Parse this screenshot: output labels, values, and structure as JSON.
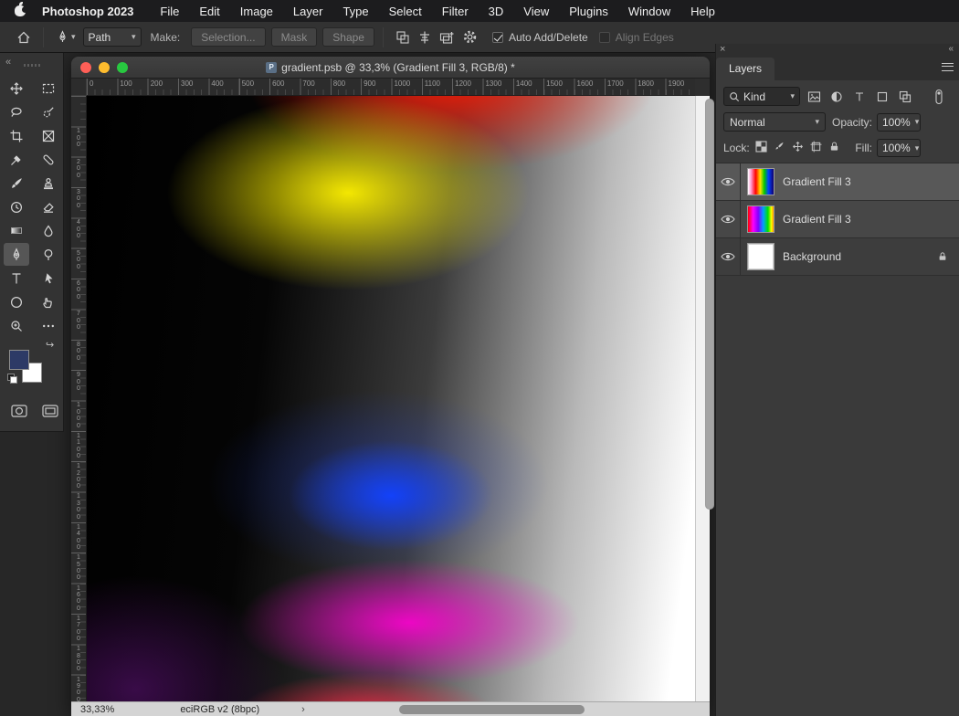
{
  "menu_bar": {
    "app_name": "Photoshop 2023",
    "items": [
      "File",
      "Edit",
      "Image",
      "Layer",
      "Type",
      "Select",
      "Filter",
      "3D",
      "View",
      "Plugins",
      "Window",
      "Help"
    ]
  },
  "options_bar": {
    "tool_mode": "Path",
    "make_label": "Make:",
    "selection_button": "Selection...",
    "mask_button": "Mask",
    "shape_button": "Shape",
    "auto_add_delete_label": "Auto Add/Delete",
    "align_edges_label": "Align Edges"
  },
  "document": {
    "title": "gradient.psb @ 33,3% (Gradient Fill 3, RGB/8) *",
    "zoom_level": "33,33%",
    "color_profile": "eciRGB v2 (8bpc)"
  },
  "rulers": {
    "horizontal": [
      "0",
      "100",
      "200",
      "300",
      "400",
      "500",
      "600",
      "700",
      "800",
      "900",
      "1000",
      "1100",
      "1200",
      "1300",
      "1400",
      "1500",
      "1600",
      "1700",
      "1800",
      "1900"
    ],
    "vertical": [
      "100",
      "200",
      "300",
      "400",
      "500",
      "600",
      "700",
      "800",
      "900",
      "1000",
      "1100",
      "1200",
      "1300",
      "1400",
      "1500",
      "1600",
      "1700",
      "1800",
      "1900"
    ]
  },
  "layers_panel": {
    "tab_label": "Layers",
    "filter_kind": "Kind",
    "blend_mode": "Normal",
    "opacity_label": "Opacity:",
    "opacity_value": "100%",
    "lock_label": "Lock:",
    "fill_label": "Fill:",
    "fill_value": "100%",
    "layers": [
      {
        "name": "Gradient Fill 3",
        "selected": true,
        "locked": false
      },
      {
        "name": "Gradient Fill 3",
        "selected": false,
        "locked": false
      },
      {
        "name": "Background",
        "selected": false,
        "locked": true
      }
    ]
  },
  "glyphs": {
    "chevron_down": "▾",
    "chevron_right": "›",
    "collapse": "«",
    "close": "×",
    "more": "…",
    "swap": "↪"
  },
  "colors": {
    "foreground": "#2d3a66",
    "background": "#ffffff"
  }
}
